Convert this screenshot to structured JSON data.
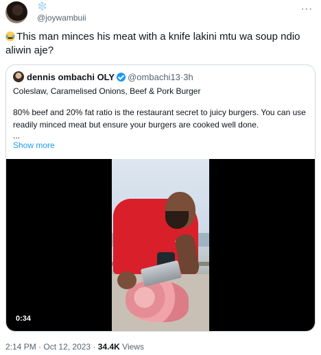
{
  "author": {
    "display_name": "❄️",
    "handle": "@joywambuii"
  },
  "more_menu": "···",
  "tweet": {
    "text": "This man minces his meat with a knife lakini mtu wa soup ndio aliwin aje?"
  },
  "quoted_tweet": {
    "display_name": "dennis ombachi OLY",
    "handle": "@ombachi13",
    "separator": "·",
    "time": "3h",
    "title": "Coleslaw, Caramelised Onions, Beef & Pork Burger",
    "body": "80% beef and 20% fat ratio is the restaurant secret to juicy burgers. You can use readily minced meat but ensure your burgers are cooked well done.",
    "ellipsis": "...",
    "show_more": "Show more",
    "video": {
      "duration": "0:34"
    }
  },
  "meta": {
    "time": "2:14 PM",
    "separator1": "·",
    "date": "Oct 12, 2023",
    "separator2": "·",
    "views_count": "34.4K",
    "views_label": "Views"
  },
  "icons": {
    "emoji": "face-with-tears-of-joy",
    "verified": "verified-badge-icon",
    "more": "more-horizontal-icon"
  },
  "colors": {
    "link": "#1d9bf0",
    "secondary_text": "#536471",
    "primary_text": "#0f1419",
    "border": "#cfd9de"
  }
}
